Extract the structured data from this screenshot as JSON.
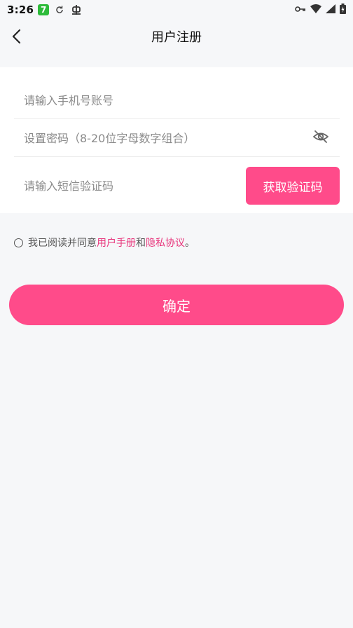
{
  "status_bar": {
    "time": "3:26",
    "app_badge": "7"
  },
  "header": {
    "title": "用户注册"
  },
  "form": {
    "phone_placeholder": "请输入手机号账号",
    "password_placeholder": "设置密码（8-20位字母数字组合）",
    "sms_placeholder": "请输入短信验证码",
    "get_code_label": "获取验证码"
  },
  "agreement": {
    "prefix": "我已阅读并同意",
    "manual_link": "用户手册",
    "and": "和",
    "privacy_link": "隐私协议",
    "suffix": "。"
  },
  "confirm_label": "确定",
  "colors": {
    "accent": "#ff4b8a",
    "link": "#e8347b",
    "background": "#f6f7f9"
  }
}
